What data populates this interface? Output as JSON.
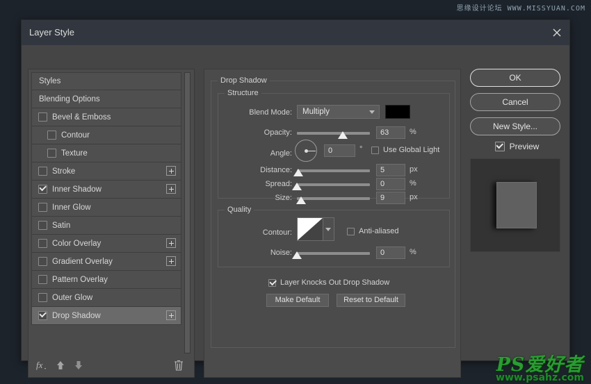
{
  "watermarks": {
    "top": "思缘设计论坛  WWW.MISSYUAN.COM",
    "bottom_line1": "PS爱好者",
    "bottom_line2": "www.psahz.com"
  },
  "dialog": {
    "title": "Layer Style",
    "close_icon": "close-icon"
  },
  "styles_panel": {
    "items": [
      {
        "label": "Styles",
        "type": "plain",
        "checked": null,
        "plus": false,
        "selected": false
      },
      {
        "label": "Blending Options",
        "type": "plain",
        "checked": null,
        "plus": false,
        "selected": false
      },
      {
        "label": "Bevel & Emboss",
        "type": "check",
        "checked": false,
        "plus": false,
        "selected": false
      },
      {
        "label": "Contour",
        "type": "subcheck",
        "checked": false,
        "plus": false,
        "selected": false
      },
      {
        "label": "Texture",
        "type": "subcheck",
        "checked": false,
        "plus": false,
        "selected": false
      },
      {
        "label": "Stroke",
        "type": "check",
        "checked": false,
        "plus": true,
        "selected": false
      },
      {
        "label": "Inner Shadow",
        "type": "check",
        "checked": true,
        "plus": true,
        "selected": false
      },
      {
        "label": "Inner Glow",
        "type": "check",
        "checked": false,
        "plus": false,
        "selected": false
      },
      {
        "label": "Satin",
        "type": "check",
        "checked": false,
        "plus": false,
        "selected": false
      },
      {
        "label": "Color Overlay",
        "type": "check",
        "checked": false,
        "plus": true,
        "selected": false
      },
      {
        "label": "Gradient Overlay",
        "type": "check",
        "checked": false,
        "plus": true,
        "selected": false
      },
      {
        "label": "Pattern Overlay",
        "type": "check",
        "checked": false,
        "plus": false,
        "selected": false
      },
      {
        "label": "Outer Glow",
        "type": "check",
        "checked": false,
        "plus": false,
        "selected": false
      },
      {
        "label": "Drop Shadow",
        "type": "check",
        "checked": true,
        "plus": true,
        "selected": true
      }
    ],
    "toolbar": {
      "fx_icon": "fx-icon",
      "move_up_icon": "arrow-up-icon",
      "move_down_icon": "arrow-down-icon",
      "delete_icon": "trash-icon"
    }
  },
  "drop_shadow": {
    "group_label": "Drop Shadow",
    "structure": {
      "legend": "Structure",
      "blend_mode_label": "Blend Mode:",
      "blend_mode_value": "Multiply",
      "shadow_color": "#000000",
      "opacity_label": "Opacity:",
      "opacity_value": "63",
      "opacity_unit": "%",
      "opacity_percent": 63,
      "angle_label": "Angle:",
      "angle_value": "0",
      "angle_unit": "°",
      "use_global_light_label": "Use Global Light",
      "use_global_light_checked": false,
      "distance_label": "Distance:",
      "distance_value": "5",
      "distance_unit": "px",
      "distance_percent": 2,
      "spread_label": "Spread:",
      "spread_value": "0",
      "spread_unit": "%",
      "spread_percent": 0,
      "size_label": "Size:",
      "size_value": "9",
      "size_unit": "px",
      "size_percent": 6
    },
    "quality": {
      "legend": "Quality",
      "contour_label": "Contour:",
      "contour_preset": "linear",
      "anti_aliased_label": "Anti-aliased",
      "anti_aliased_checked": false,
      "noise_label": "Noise:",
      "noise_value": "0",
      "noise_unit": "%",
      "noise_percent": 0
    },
    "knockout_label": "Layer Knocks Out Drop Shadow",
    "knockout_checked": true,
    "make_default_label": "Make Default",
    "reset_default_label": "Reset to Default"
  },
  "actions": {
    "ok_label": "OK",
    "cancel_label": "Cancel",
    "new_style_label": "New Style...",
    "preview_label": "Preview",
    "preview_checked": true
  },
  "colors": {
    "dialog_bg": "#454545",
    "titlebar_bg": "#32373f",
    "panel_bg": "#4b4b4b",
    "desktop_bg": "#1d232b",
    "selected_row": "#6a6a6a",
    "text": "#d8d8d8"
  }
}
